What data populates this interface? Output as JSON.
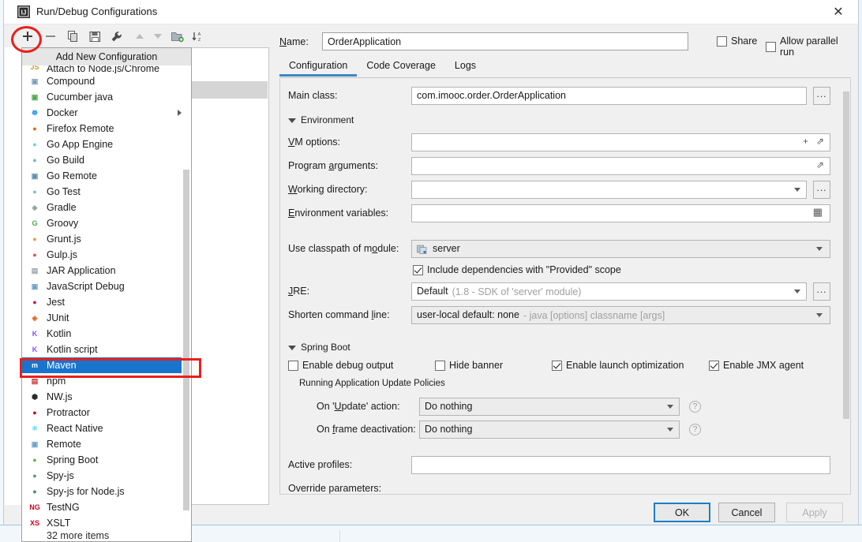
{
  "window": {
    "title": "Run/Debug Configurations",
    "close_label": "✕",
    "app_icon": "intellij-idea-icon"
  },
  "toolbar": {
    "buttons": [
      {
        "name": "add-configuration-button",
        "icon": "plus-icon",
        "label": "+"
      },
      {
        "name": "remove-configuration-button",
        "icon": "minus-icon",
        "label": "−"
      },
      {
        "name": "copy-configuration-button",
        "icon": "copy-icon",
        "label": ""
      },
      {
        "name": "save-configuration-button",
        "icon": "save-icon",
        "label": ""
      },
      {
        "name": "edit-templates-button",
        "icon": "wrench-icon",
        "label": ""
      },
      {
        "name": "move-up-button",
        "icon": "arrow-up-icon",
        "label": ""
      },
      {
        "name": "move-down-button",
        "icon": "arrow-down-icon",
        "label": ""
      },
      {
        "name": "new-folder-button",
        "icon": "folder-add-icon",
        "label": ""
      },
      {
        "name": "sort-configurations-button",
        "icon": "sort-az-icon",
        "label": ""
      }
    ]
  },
  "popup": {
    "header": "Add New Configuration",
    "items": [
      {
        "label": "Attach to Node.js/Chrome",
        "icon": "nodejs-attach-icon",
        "icon_glyph": "JS",
        "icon_color": "#c9a227",
        "clipped": true
      },
      {
        "label": "Compound",
        "icon": "compound-icon",
        "icon_glyph": "▣",
        "icon_color": "#7a9fbe"
      },
      {
        "label": "Cucumber java",
        "icon": "cucumber-icon",
        "icon_glyph": "▣",
        "icon_color": "#4aa84a"
      },
      {
        "label": "Docker",
        "icon": "docker-icon",
        "icon_glyph": "☸",
        "icon_color": "#2496ed",
        "submenu": true
      },
      {
        "label": "Firefox Remote",
        "icon": "firefox-icon",
        "icon_glyph": "●",
        "icon_color": "#e8651a"
      },
      {
        "label": "Go App Engine",
        "icon": "go-appengine-icon",
        "icon_glyph": "●",
        "icon_color": "#6ad0e2"
      },
      {
        "label": "Go Build",
        "icon": "go-build-icon",
        "icon_glyph": "●",
        "icon_color": "#76b5c5"
      },
      {
        "label": "Go Remote",
        "icon": "go-remote-icon",
        "icon_glyph": "▣",
        "icon_color": "#5a8fa8"
      },
      {
        "label": "Go Test",
        "icon": "go-test-icon",
        "icon_glyph": "●",
        "icon_color": "#8fb8c9"
      },
      {
        "label": "Gradle",
        "icon": "gradle-icon",
        "icon_glyph": "◆",
        "icon_color": "#9aa5ab"
      },
      {
        "label": "Groovy",
        "icon": "groovy-icon",
        "icon_glyph": "G",
        "icon_color": "#4aa84a"
      },
      {
        "label": "Grunt.js",
        "icon": "grunt-icon",
        "icon_glyph": "●",
        "icon_color": "#e0a03a"
      },
      {
        "label": "Gulp.js",
        "icon": "gulp-icon",
        "icon_glyph": "●",
        "icon_color": "#d9534f"
      },
      {
        "label": "JAR Application",
        "icon": "jar-icon",
        "icon_glyph": "▤",
        "icon_color": "#9aa5ab"
      },
      {
        "label": "JavaScript Debug",
        "icon": "javascript-debug-icon",
        "icon_glyph": "▣",
        "icon_color": "#6aa0c9"
      },
      {
        "label": "Jest",
        "icon": "jest-icon",
        "icon_glyph": "●",
        "icon_color": "#c2185b"
      },
      {
        "label": "JUnit",
        "icon": "junit-icon",
        "icon_glyph": "◈",
        "icon_color": "#e06c2a"
      },
      {
        "label": "Kotlin",
        "icon": "kotlin-icon",
        "icon_glyph": "K",
        "icon_color": "#7f52ff"
      },
      {
        "label": "Kotlin script",
        "icon": "kotlin-script-icon",
        "icon_glyph": "K",
        "icon_color": "#7f52ff"
      },
      {
        "label": "Maven",
        "icon": "maven-icon",
        "icon_glyph": "m",
        "icon_color": "#ffffff",
        "selected": true
      },
      {
        "label": "npm",
        "icon": "npm-icon",
        "icon_glyph": "▤",
        "icon_color": "#cb3837"
      },
      {
        "label": "NW.js",
        "icon": "nwjs-icon",
        "icon_glyph": "⬢",
        "icon_color": "#2b2b2b"
      },
      {
        "label": "Protractor",
        "icon": "protractor-icon",
        "icon_glyph": "●",
        "icon_color": "#d0021b"
      },
      {
        "label": "React Native",
        "icon": "react-native-icon",
        "icon_glyph": "⚛",
        "icon_color": "#61dafb"
      },
      {
        "label": "Remote",
        "icon": "remote-icon",
        "icon_glyph": "▣",
        "icon_color": "#6aa0c9"
      },
      {
        "label": "Spring Boot",
        "icon": "spring-boot-icon",
        "icon_glyph": "●",
        "icon_color": "#6db33f"
      },
      {
        "label": "Spy-js",
        "icon": "spy-js-icon",
        "icon_glyph": "●",
        "icon_color": "#5a8fa8"
      },
      {
        "label": "Spy-js for Node.js",
        "icon": "spy-js-node-icon",
        "icon_glyph": "●",
        "icon_color": "#4a8a6a"
      },
      {
        "label": "TestNG",
        "icon": "testng-icon",
        "icon_glyph": "NG",
        "icon_color": "#d0021b"
      },
      {
        "label": "XSLT",
        "icon": "xslt-icon",
        "icon_glyph": "XS",
        "icon_color": "#d0021b"
      },
      {
        "label": "32 more items",
        "icon": "more-items-icon",
        "icon_glyph": "",
        "icon_color": "#808080",
        "last_partial": true
      }
    ]
  },
  "header": {
    "name_label": "Name:",
    "name_value": "OrderApplication",
    "share_label": "Share",
    "share_checked": false,
    "allow_parallel_label": "Allow parallel run",
    "allow_parallel_checked": false
  },
  "tabs": [
    {
      "label": "Configuration",
      "active": true
    },
    {
      "label": "Code Coverage",
      "active": false
    },
    {
      "label": "Logs",
      "active": false
    }
  ],
  "configuration": {
    "main_class_label": "Main class:",
    "main_class_value": "com.imooc.order.OrderApplication",
    "browse_label": "...",
    "environment_group": "Environment",
    "vm_options_label": "VM options:",
    "vm_options_value": "",
    "program_arguments_label": "Program arguments:",
    "program_arguments_value": "",
    "working_directory_label": "Working directory:",
    "working_directory_value": "",
    "environment_variables_label": "Environment variables:",
    "environment_variables_value": "",
    "use_classpath_label": "Use classpath of module:",
    "use_classpath_value": "server",
    "include_dependencies_label": "Include dependencies with \"Provided\" scope",
    "include_dependencies_checked": true,
    "jre_label": "JRE:",
    "jre_value": "Default",
    "jre_hint": "(1.8 - SDK of 'server' module)",
    "shorten_command_label": "Shorten command line:",
    "shorten_command_value": "user-local default: none",
    "shorten_command_hint": "- java [options] classname [args]"
  },
  "spring_boot": {
    "group_label": "Spring Boot",
    "checkboxes": [
      {
        "label": "Enable debug output",
        "checked": false,
        "name": "enable-debug-output-checkbox"
      },
      {
        "label": "Hide banner",
        "checked": false,
        "name": "hide-banner-checkbox"
      },
      {
        "label": "Enable launch optimization",
        "checked": true,
        "name": "enable-launch-optimization-checkbox"
      },
      {
        "label": "Enable JMX agent",
        "checked": true,
        "name": "enable-jmx-agent-checkbox"
      }
    ],
    "update_policies_label": "Running Application Update Policies",
    "on_update_label": "On 'Update' action:",
    "on_update_value": "Do nothing",
    "on_frame_label": "On frame deactivation:",
    "on_frame_value": "Do nothing",
    "help_glyph": "?",
    "active_profiles_label": "Active profiles:",
    "active_profiles_value": "",
    "override_parameters_label": "Override parameters:"
  },
  "footer": {
    "ok_label": "OK",
    "cancel_label": "Cancel",
    "apply_label": "Apply"
  },
  "colors": {
    "accent": "#3e86c9",
    "selection": "#1874cd",
    "annotation_red": "#e8201d",
    "dialog_bg": "#f0f0f0"
  }
}
